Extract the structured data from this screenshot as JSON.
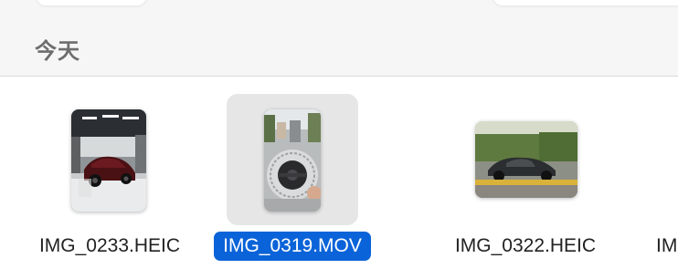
{
  "section": {
    "title": "今天"
  },
  "files": [
    {
      "name": "IMG_0233.HEIC",
      "icon": "photo-thumbnail",
      "selected": false
    },
    {
      "name": "IMG_0319.MOV",
      "icon": "video-thumbnail",
      "selected": true
    },
    {
      "name": "IMG_0322.HEIC",
      "icon": "photo-thumbnail",
      "selected": false
    },
    {
      "name": "IM",
      "icon": "partial-file",
      "selected": false
    }
  ],
  "colors": {
    "selection": "#0a63d8",
    "selected_tile": "#e6e6e6",
    "header_bg": "#f6f6f6"
  }
}
